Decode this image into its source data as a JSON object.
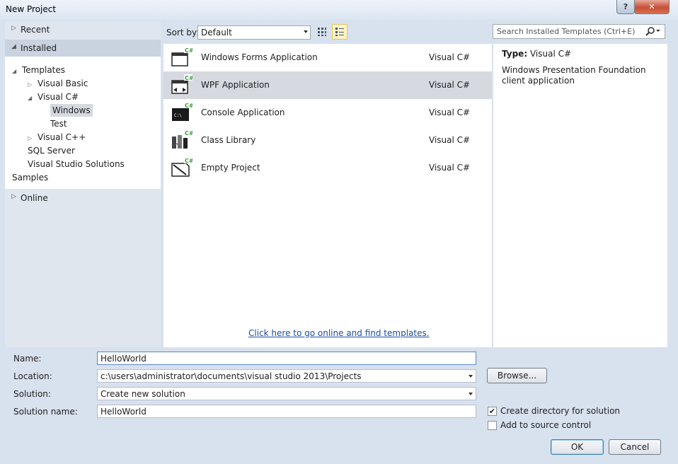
{
  "window": {
    "title": "New Project",
    "help_label": "?",
    "close_label": "✕"
  },
  "nav": {
    "recent": "Recent",
    "installed": "Installed",
    "online": "Online",
    "tree": [
      {
        "label": "Templates",
        "arrow": "◢",
        "indent": 0
      },
      {
        "label": "Visual Basic",
        "arrow": "▷",
        "indent": 1
      },
      {
        "label": "Visual C#",
        "arrow": "◢",
        "indent": 1
      },
      {
        "label": "Windows",
        "arrow": "",
        "indent": 2,
        "selected": true
      },
      {
        "label": "Test",
        "arrow": "",
        "indent": 2
      },
      {
        "label": "Visual C++",
        "arrow": "▷",
        "indent": 1
      },
      {
        "label": "SQL Server",
        "arrow": "",
        "indent": 1
      },
      {
        "label": "Visual Studio Solutions",
        "arrow": "",
        "indent": 1
      },
      {
        "label": "Samples",
        "arrow": "",
        "indent": 0
      }
    ]
  },
  "sort": {
    "label": "Sort by:",
    "value": "Default"
  },
  "templates": [
    {
      "name": "Windows Forms Application",
      "lang": "Visual C#",
      "icon": "windows-forms-icon"
    },
    {
      "name": "WPF Application",
      "lang": "Visual C#",
      "icon": "wpf-icon",
      "selected": true
    },
    {
      "name": "Console Application",
      "lang": "Visual C#",
      "icon": "console-icon"
    },
    {
      "name": "Class Library",
      "lang": "Visual C#",
      "icon": "class-library-icon"
    },
    {
      "name": "Empty Project",
      "lang": "Visual C#",
      "icon": "empty-project-icon"
    }
  ],
  "online_link": "Click here to go online and find templates.",
  "search": {
    "placeholder": "Search Installed Templates (Ctrl+E)"
  },
  "details": {
    "type_label": "Type:",
    "type_value": "Visual C#",
    "description": "Windows Presentation Foundation client application"
  },
  "form": {
    "name_label": "Name:",
    "name_value": "HelloWorld",
    "location_label": "Location:",
    "location_value": "c:\\users\\administrator\\documents\\visual studio 2013\\Projects",
    "solution_label": "Solution:",
    "solution_value": "Create new solution",
    "solution_name_label": "Solution name:",
    "solution_name_value": "HelloWorld",
    "browse_label": "Browse...",
    "create_dir_label": "Create directory for solution",
    "create_dir_checked": true,
    "source_control_label": "Add to source control",
    "source_control_checked": false,
    "ok_label": "OK",
    "cancel_label": "Cancel"
  }
}
